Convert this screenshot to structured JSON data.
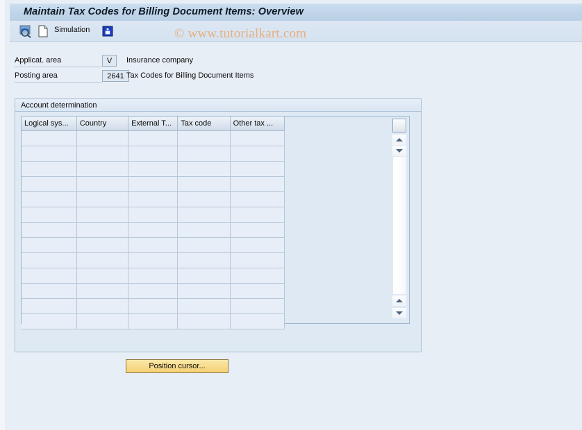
{
  "window": {
    "title": "Maintain Tax Codes for Billing Document Items: Overview"
  },
  "toolbar": {
    "display_icon": "magnifier-display-icon",
    "new_document_icon": "document-icon",
    "simulation_label": "Simulation",
    "info_icon": "info-icon"
  },
  "watermark": {
    "text": "© www.tutorialkart.com",
    "color": "#e7b07f"
  },
  "header_fields": {
    "application_area": {
      "label": "Applicat. area",
      "value": "V",
      "description": "Insurance company"
    },
    "posting_area": {
      "label": "Posting area",
      "value": "2641",
      "description": "Tax Codes for Billing Document Items"
    }
  },
  "panel": {
    "title": "Account determination",
    "table": {
      "columns": [
        "Logical sys...",
        "Country",
        "External T...",
        "Tax code",
        "Other tax ..."
      ],
      "rows": [
        [
          "",
          "",
          "",
          "",
          ""
        ],
        [
          "",
          "",
          "",
          "",
          ""
        ],
        [
          "",
          "",
          "",
          "",
          ""
        ],
        [
          "",
          "",
          "",
          "",
          ""
        ],
        [
          "",
          "",
          "",
          "",
          ""
        ],
        [
          "",
          "",
          "",
          "",
          ""
        ],
        [
          "",
          "",
          "",
          "",
          ""
        ],
        [
          "",
          "",
          "",
          "",
          ""
        ],
        [
          "",
          "",
          "",
          "",
          ""
        ],
        [
          "",
          "",
          "",
          "",
          ""
        ],
        [
          "",
          "",
          "",
          "",
          ""
        ],
        [
          "",
          "",
          "",
          "",
          ""
        ],
        [
          "",
          "",
          "",
          "",
          ""
        ]
      ],
      "row_count": 13
    },
    "scrollbar": {
      "select_all": "select-all-corner",
      "scroll_up_top": "scroll-up-icon",
      "scroll_down_top": "scroll-down-icon",
      "scroll_up_bottom": "scroll-up-icon",
      "scroll_down_bottom": "scroll-down-icon"
    }
  },
  "footer": {
    "position_cursor_label": "Position cursor..."
  },
  "colors": {
    "window_background": "#e8eef6",
    "title_bar": "#c2d6ea",
    "panel_background": "#dfe9f4",
    "grid_cell": "#e7eef7",
    "button_yellow": "#f8dc8c"
  }
}
